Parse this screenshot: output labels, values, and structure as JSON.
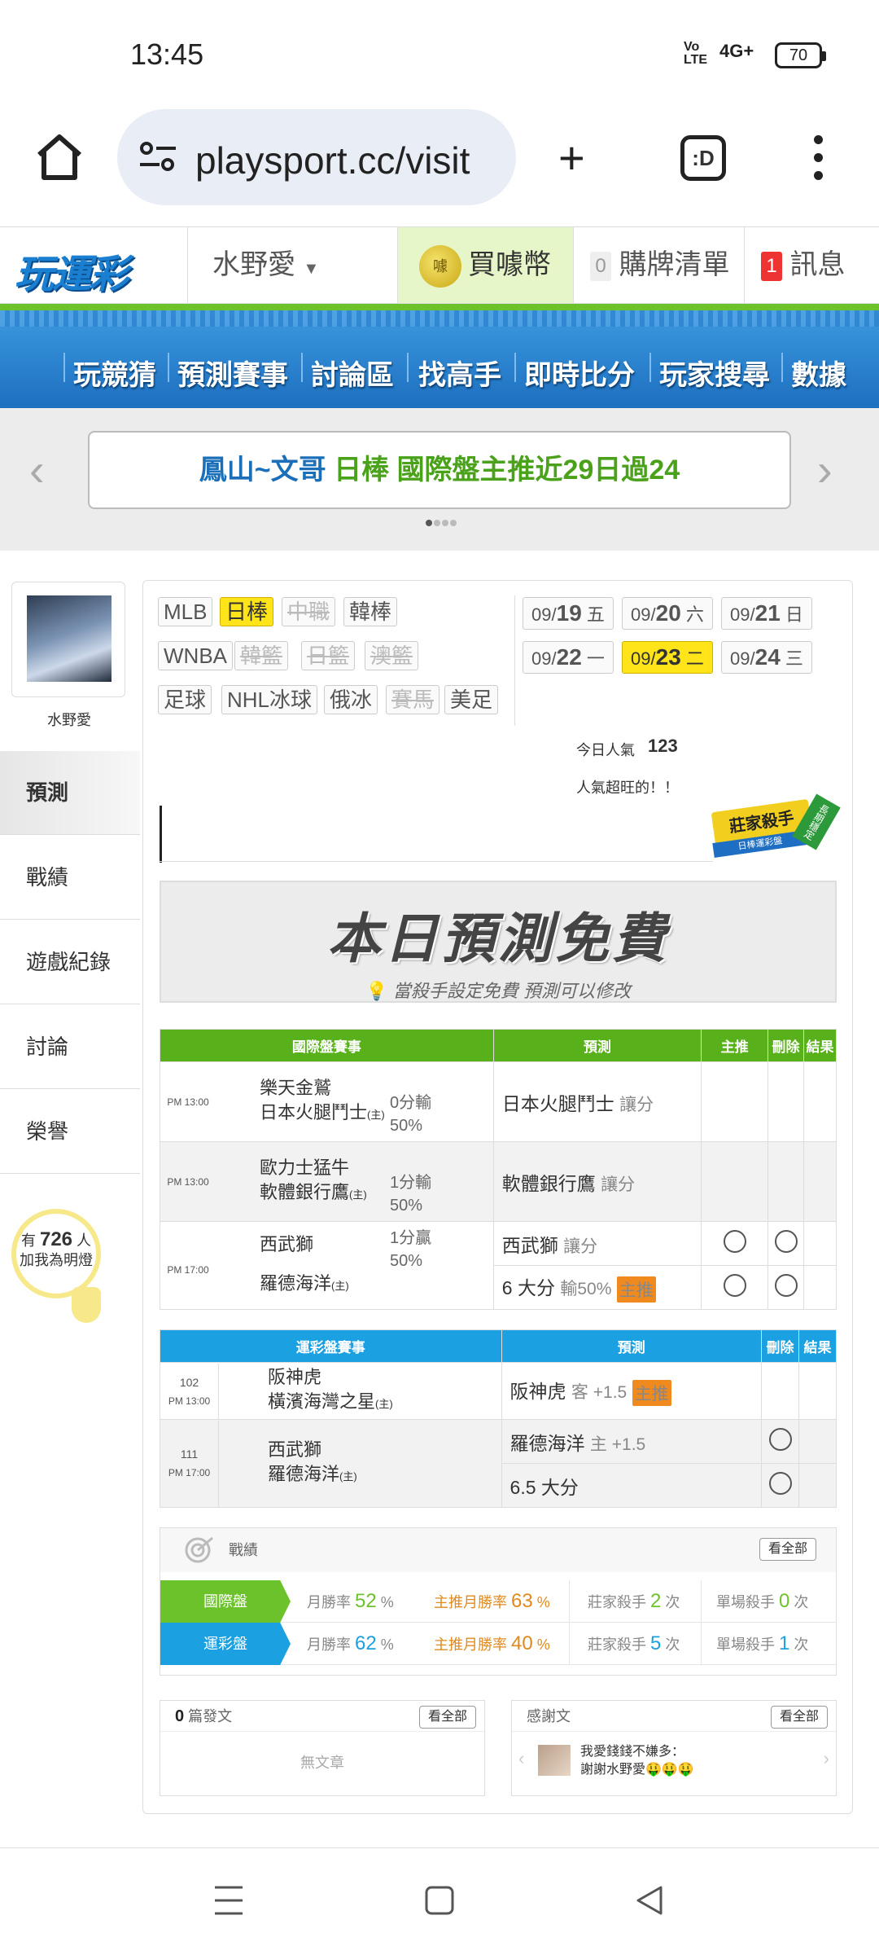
{
  "status": {
    "time": "13:45",
    "volte": "Vo LTE",
    "network": "4G+",
    "battery": "70"
  },
  "browser": {
    "url": "playsport.cc/visit",
    "tabs": ":D"
  },
  "site": {
    "logo": "玩運彩",
    "user": "水野愛",
    "coin": "買噱幣",
    "coin_icon_text": "噱",
    "cart_count": "0",
    "cart": "購牌清單",
    "msg_count": "1",
    "msg": "訊息"
  },
  "nav": [
    "玩競猜",
    "預測賽事",
    "討論區",
    "找高手",
    "即時比分",
    "玩家搜尋",
    "數據"
  ],
  "banner": {
    "part1": "鳳山~文哥",
    "part2": "日棒",
    "part3": "國際盤主推近29日過24"
  },
  "sidebar": {
    "username": "水野愛",
    "items": [
      "預測",
      "戰績",
      "遊戲紀錄",
      "討論",
      "榮譽"
    ],
    "bulb": {
      "pre": "有",
      "count": "726",
      "unit": "人",
      "line2": "加我為明燈"
    }
  },
  "leagues": [
    "MLB",
    "日棒",
    "中職",
    "韓棒",
    "WNBA",
    "韓籃",
    "日籃",
    "澳籃",
    "足球",
    "NHL冰球",
    "俄冰",
    "賽馬",
    "美足"
  ],
  "dates": [
    {
      "md": "09/",
      "d": "19",
      "w": "五"
    },
    {
      "md": "09/",
      "d": "20",
      "w": "六"
    },
    {
      "md": "09/",
      "d": "21",
      "w": "日"
    },
    {
      "md": "09/",
      "d": "22",
      "w": "一"
    },
    {
      "md": "09/",
      "d": "23",
      "w": "二"
    },
    {
      "md": "09/",
      "d": "24",
      "w": "三"
    }
  ],
  "popularity": {
    "label": "今日人氣",
    "value": "123",
    "note": "人氣超旺的！！"
  },
  "killer": {
    "title": "莊家殺手",
    "sub": "日棒運彩盤",
    "stamp": "長期穩定"
  },
  "free": {
    "title": "本日預測免費",
    "sub": "當殺手設定免費 預測可以修改"
  },
  "intl_table": {
    "headers": [
      "國際盤賽事",
      "預測",
      "主推",
      "刪除",
      "結果"
    ],
    "rows": [
      {
        "time": "PM 13:00",
        "away": "樂天金鷲",
        "home": "日本火腿鬥士",
        "home_mark": "(主)",
        "line": "0分輸",
        "pct": "50%",
        "pick": "日本火腿鬥士",
        "type": "讓分"
      },
      {
        "time": "PM 13:00",
        "away": "歐力士猛牛",
        "home": "軟體銀行鷹",
        "home_mark": "(主)",
        "line": "1分輸",
        "pct": "50%",
        "pick": "軟體銀行鷹",
        "type": "讓分"
      },
      {
        "time": "PM 17:00",
        "away": "西武獅",
        "home": "羅德海洋",
        "home_mark": "(主)",
        "line": "1分贏",
        "pct": "50%",
        "pick": "西武獅",
        "type": "讓分",
        "pick2": "6 大分",
        "type2": "輸50%",
        "badge": "主推"
      }
    ]
  },
  "lottery_table": {
    "headers": [
      "運彩盤賽事",
      "預測",
      "刪除",
      "結果"
    ],
    "rows": [
      {
        "no": "102",
        "time": "PM 13:00",
        "away": "阪神虎",
        "home": "橫濱海灣之星",
        "home_mark": "(主)",
        "pick": "阪神虎",
        "type": "客 +1.5",
        "badge": "主推"
      },
      {
        "no": "111",
        "time": "PM 17:00",
        "away": "西武獅",
        "home": "羅德海洋",
        "home_mark": "(主)",
        "pick": "羅德海洋",
        "type": "主 +1.5",
        "pick2": "6.5 大分"
      }
    ]
  },
  "record": {
    "title": "戰績",
    "all": "看全部",
    "rows": [
      {
        "label": "國際盤",
        "color": "#6cc22b",
        "month_label": "月勝率",
        "month": "52",
        "main_label": "主推月勝率",
        "main": "63",
        "killer_label": "莊家殺手",
        "killer": "2",
        "single_label": "單場殺手",
        "single": "0",
        "unit": "次",
        "pct": "%"
      },
      {
        "label": "運彩盤",
        "color": "#1ba0e1",
        "month_label": "月勝率",
        "month": "62",
        "main_label": "主推月勝率",
        "main": "40",
        "killer_label": "莊家殺手",
        "killer": "5",
        "single_label": "單場殺手",
        "single": "1",
        "unit": "次",
        "pct": "%"
      }
    ]
  },
  "posts": {
    "count": "0",
    "label": "篇發文",
    "all": "看全部",
    "empty": "無文章"
  },
  "thanks": {
    "label": "感謝文",
    "all": "看全部",
    "user": "我愛錢錢不嫌多：",
    "msg": "謝謝水野愛🤑🤑🤑"
  }
}
